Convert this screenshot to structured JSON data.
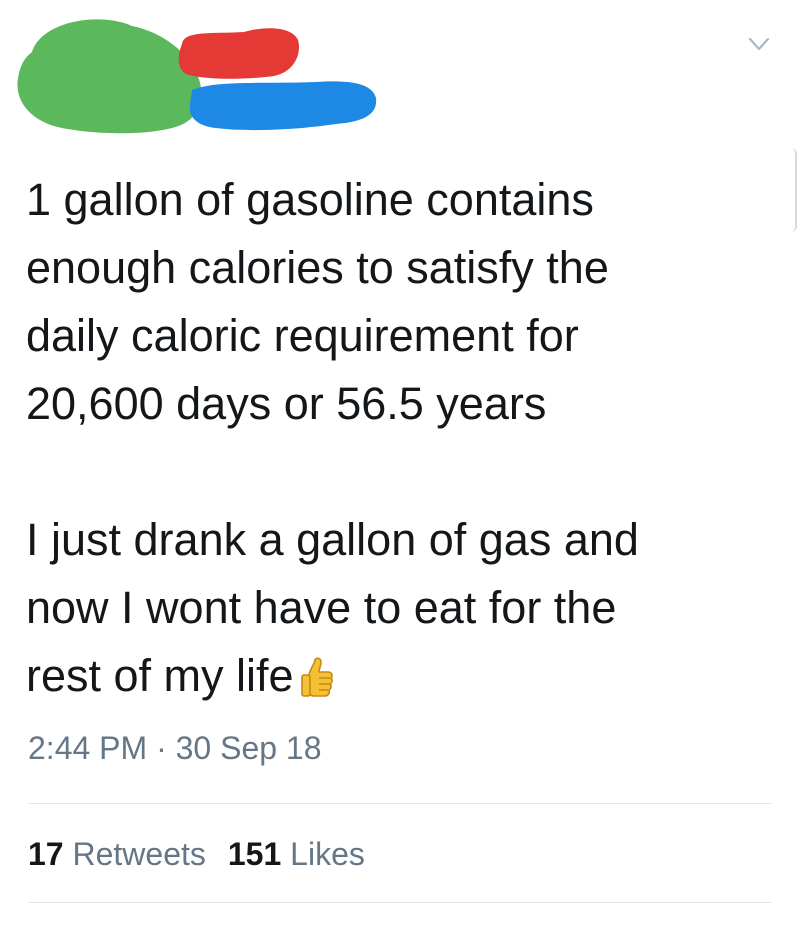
{
  "tweet": {
    "text_lines": [
      "1 gallon of gasoline contains",
      "enough calories to satisfy the",
      "daily caloric requirement for",
      "20,600 days or 56.5 years",
      "I just drank a gallon of gas and",
      "now I wont have to eat for the",
      "rest of my life"
    ],
    "emoji_icon": "thumbs-up-icon",
    "timestamp": "2:44 PM · 30 Sep 18",
    "stats": {
      "retweets_count": "17",
      "retweets_label": "Retweets",
      "likes_count": "151",
      "likes_label": "Likes"
    },
    "menu_icon": "chevron-down-icon"
  },
  "colors": {
    "text": "#14171a",
    "muted": "#657786",
    "divider": "#e1e8ed",
    "redaction_green": "#5cb85c",
    "redaction_red": "#e53935",
    "redaction_blue": "#1e88e5"
  }
}
